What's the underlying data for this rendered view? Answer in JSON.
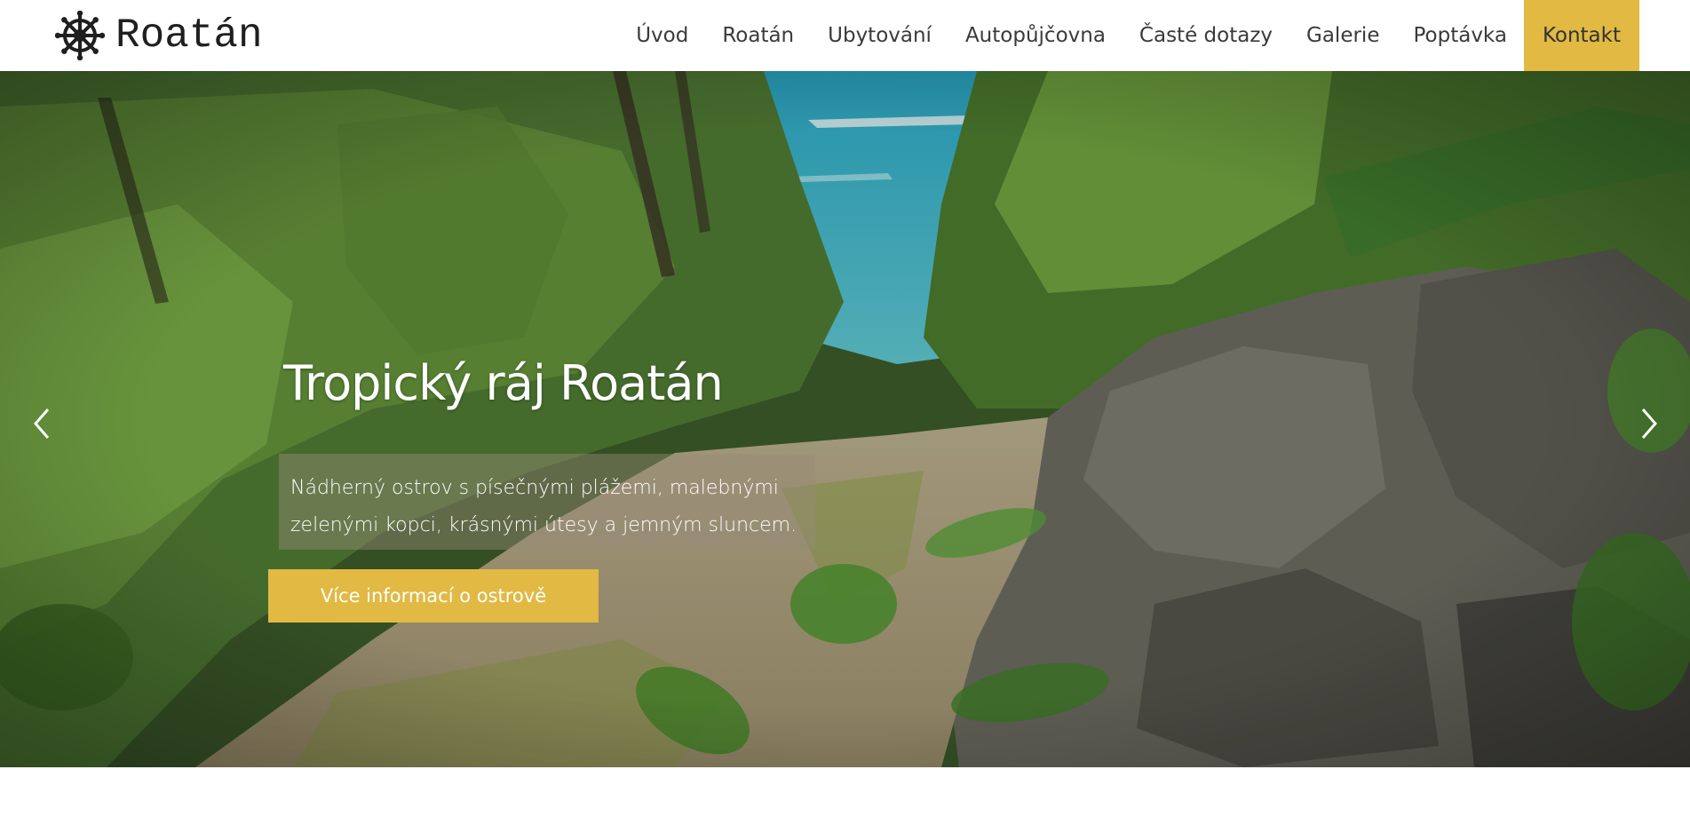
{
  "brand": {
    "name": "Roatán",
    "logo_icon": "ship-wheel-icon"
  },
  "nav": {
    "items": [
      {
        "label": "Úvod"
      },
      {
        "label": "Roatán"
      },
      {
        "label": "Ubytování"
      },
      {
        "label": "Autopůjčovna"
      },
      {
        "label": "Časté dotazy"
      },
      {
        "label": "Galerie"
      },
      {
        "label": "Poptávka"
      },
      {
        "label": "Kontakt",
        "active": true
      }
    ]
  },
  "hero": {
    "title": "Tropický ráj Roatán",
    "description": "Nádherný ostrov s písečnými plážemi, malebnými zelenými kopci, krásnými útesy a jemným sluncem.",
    "cta_label": "Více informací o ostrově",
    "prev_icon": "chevron-left-icon",
    "next_icon": "chevron-right-icon"
  },
  "colors": {
    "accent": "#e1b943",
    "text_dark": "#3a3a3a",
    "white": "#ffffff"
  }
}
